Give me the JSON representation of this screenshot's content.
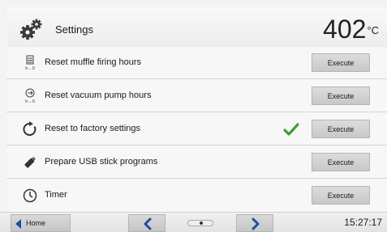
{
  "header": {
    "title": "Settings",
    "icon": "gears-icon",
    "temperature": "402",
    "temperature_unit": "°C"
  },
  "rows": [
    {
      "label": "Reset muffle firing hours",
      "icon": "muffle-hours-reset-icon",
      "button": "Execute",
      "checked": false
    },
    {
      "label": "Reset vacuum pump hours",
      "icon": "vacuum-pump-hours-reset-icon",
      "button": "Execute",
      "checked": false
    },
    {
      "label": "Reset to factory settings",
      "icon": "refresh-icon",
      "button": "Execute",
      "checked": true
    },
    {
      "label": "Prepare USB stick programs",
      "icon": "usb-stick-icon",
      "button": "Execute",
      "checked": false
    },
    {
      "label": "Timer",
      "icon": "clock-icon",
      "button": "Execute",
      "checked": false
    }
  ],
  "footer": {
    "home_label": "Home",
    "time": "15:27:17"
  },
  "colors": {
    "accent_blue": "#1d4f9c",
    "check_green": "#3aa032"
  }
}
